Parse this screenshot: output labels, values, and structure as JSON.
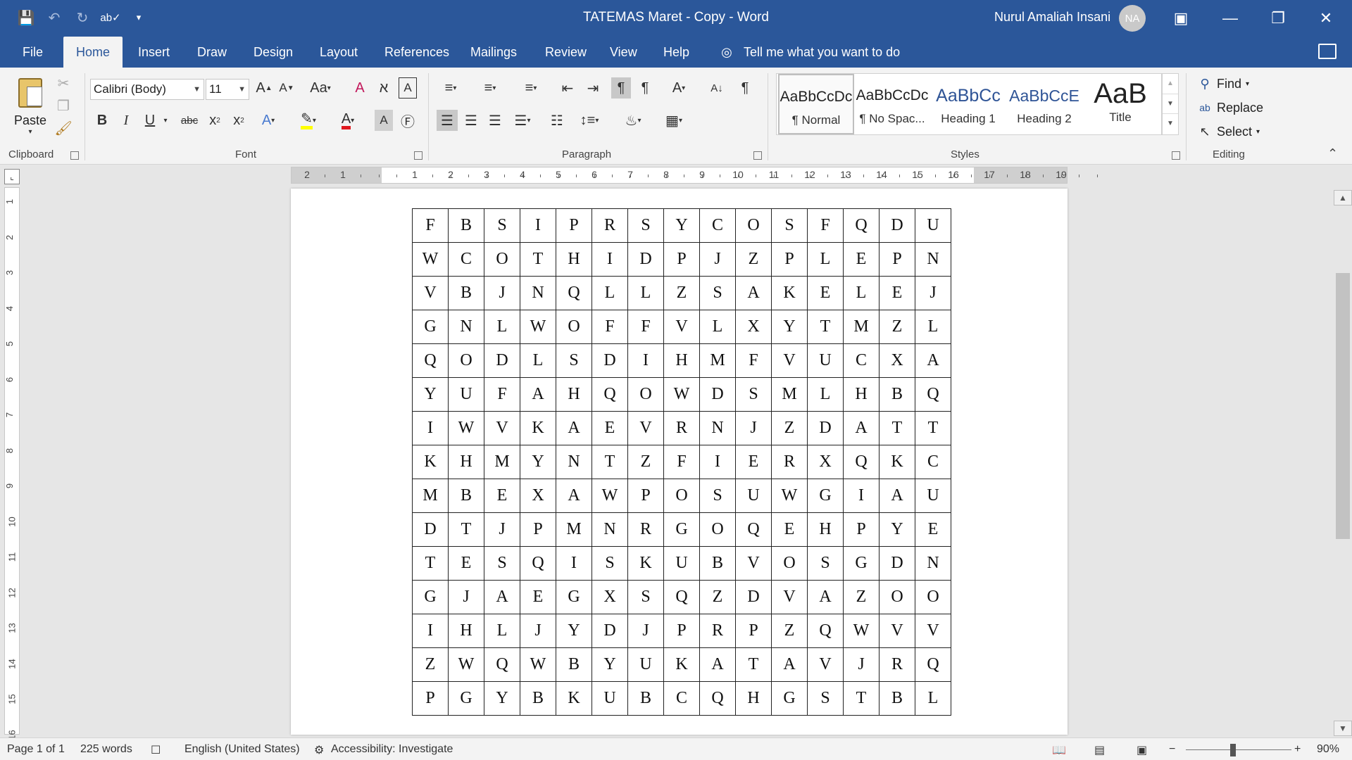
{
  "window": {
    "title": "TATEMAS Maret - Copy  -  Word",
    "user_name": "Nurul Amaliah Insani",
    "user_initials": "NA"
  },
  "tabs": [
    "File",
    "Home",
    "Insert",
    "Draw",
    "Design",
    "Layout",
    "References",
    "Mailings",
    "Review",
    "View",
    "Help"
  ],
  "active_tab": "Home",
  "tell_me": "Tell me what you want to do",
  "ribbon": {
    "clipboard": {
      "label": "Clipboard",
      "paste": "Paste"
    },
    "font": {
      "label": "Font",
      "family": "Calibri (Body)",
      "size": "11"
    },
    "paragraph": {
      "label": "Paragraph"
    },
    "styles": {
      "label": "Styles",
      "items": [
        {
          "preview": "AaBbCcDc",
          "name": "¶ Normal"
        },
        {
          "preview": "AaBbCcDc",
          "name": "¶ No Spac..."
        },
        {
          "preview": "AaBbCc",
          "name": "Heading 1"
        },
        {
          "preview": "AaBbCcE",
          "name": "Heading 2"
        },
        {
          "preview": "AaB",
          "name": "Title"
        }
      ]
    },
    "editing": {
      "label": "Editing",
      "find": "Find",
      "replace": "Replace",
      "select": "Select"
    }
  },
  "ruler": {
    "h_numbers": [
      "2",
      "1",
      "1",
      "2",
      "3",
      "4",
      "5",
      "6",
      "7",
      "8",
      "9",
      "10",
      "11",
      "12",
      "13",
      "14",
      "15",
      "16",
      "17",
      "18",
      "19"
    ],
    "v_numbers": [
      "1",
      "2",
      "3",
      "4",
      "5",
      "6",
      "7",
      "8",
      "9",
      "10",
      "11",
      "12",
      "13",
      "14",
      "15",
      "16"
    ]
  },
  "grid": [
    [
      "F",
      "B",
      "S",
      "I",
      "P",
      "R",
      "S",
      "Y",
      "C",
      "O",
      "S",
      "F",
      "Q",
      "D",
      "U"
    ],
    [
      "W",
      "C",
      "O",
      "T",
      "H",
      "I",
      "D",
      "P",
      "J",
      "Z",
      "P",
      "L",
      "E",
      "P",
      "N"
    ],
    [
      "V",
      "B",
      "J",
      "N",
      "Q",
      "L",
      "L",
      "Z",
      "S",
      "A",
      "K",
      "E",
      "L",
      "E",
      "J"
    ],
    [
      "G",
      "N",
      "L",
      "W",
      "O",
      "F",
      "F",
      "V",
      "L",
      "X",
      "Y",
      "T",
      "M",
      "Z",
      "L"
    ],
    [
      "Q",
      "O",
      "D",
      "L",
      "S",
      "D",
      "I",
      "H",
      "M",
      "F",
      "V",
      "U",
      "C",
      "X",
      "A"
    ],
    [
      "Y",
      "U",
      "F",
      "A",
      "H",
      "Q",
      "O",
      "W",
      "D",
      "S",
      "M",
      "L",
      "H",
      "B",
      "Q"
    ],
    [
      "I",
      "W",
      "V",
      "K",
      "A",
      "E",
      "V",
      "R",
      "N",
      "J",
      "Z",
      "D",
      "A",
      "T",
      "T"
    ],
    [
      "K",
      "H",
      "M",
      "Y",
      "N",
      "T",
      "Z",
      "F",
      "I",
      "E",
      "R",
      "X",
      "Q",
      "K",
      "C"
    ],
    [
      "M",
      "B",
      "E",
      "X",
      "A",
      "W",
      "P",
      "O",
      "S",
      "U",
      "W",
      "G",
      "I",
      "A",
      "U"
    ],
    [
      "D",
      "T",
      "J",
      "P",
      "M",
      "N",
      "R",
      "G",
      "O",
      "Q",
      "E",
      "H",
      "P",
      "Y",
      "E"
    ],
    [
      "T",
      "E",
      "S",
      "Q",
      "I",
      "S",
      "K",
      "U",
      "B",
      "V",
      "O",
      "S",
      "G",
      "D",
      "N"
    ],
    [
      "G",
      "J",
      "A",
      "E",
      "G",
      "X",
      "S",
      "Q",
      "Z",
      "D",
      "V",
      "A",
      "Z",
      "O",
      "O"
    ],
    [
      "I",
      "H",
      "L",
      "J",
      "Y",
      "D",
      "J",
      "P",
      "R",
      "P",
      "Z",
      "Q",
      "W",
      "V",
      "V"
    ],
    [
      "Z",
      "W",
      "Q",
      "W",
      "B",
      "Y",
      "U",
      "K",
      "A",
      "T",
      "A",
      "V",
      "J",
      "R",
      "Q"
    ],
    [
      "P",
      "G",
      "Y",
      "B",
      "K",
      "U",
      "B",
      "C",
      "Q",
      "H",
      "G",
      "S",
      "T",
      "B",
      "L"
    ]
  ],
  "status": {
    "page": "Page 1 of 1",
    "words": "225 words",
    "language": "English (United States)",
    "accessibility": "Accessibility: Investigate",
    "zoom": "90%"
  }
}
